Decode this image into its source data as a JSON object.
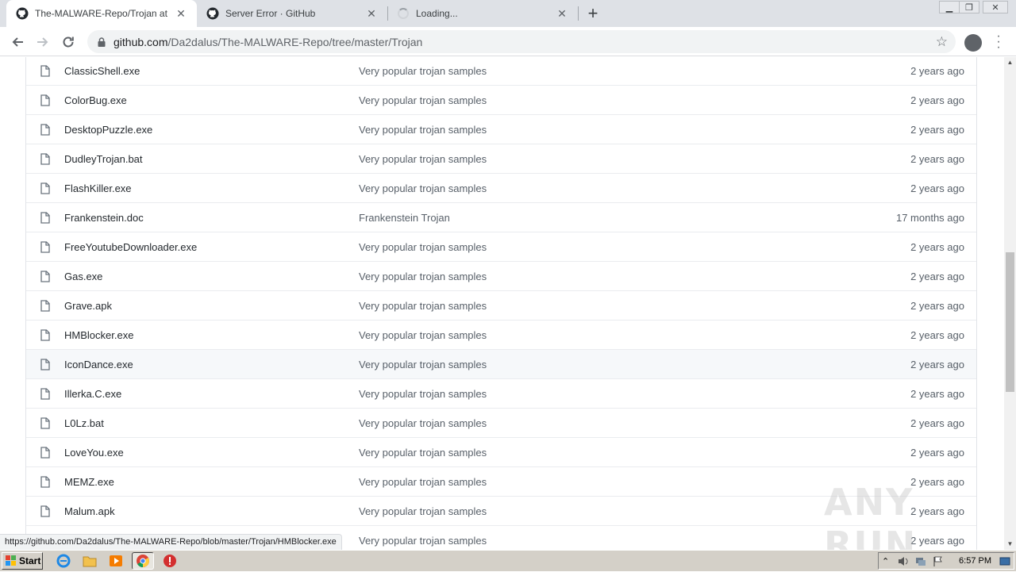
{
  "browser": {
    "tabs": [
      {
        "title": "The-MALWARE-Repo/Trojan at master",
        "active": true
      },
      {
        "title": "Server Error · GitHub",
        "active": false
      },
      {
        "title": "Loading...",
        "active": false
      }
    ],
    "new_tab_label": "+",
    "url_host": "github.com",
    "url_path": "/Da2dalus/The-MALWARE-Repo/tree/master/Trojan"
  },
  "files": [
    {
      "name": "ClassicShell.exe",
      "message": "Very popular trojan samples",
      "age": "2 years ago"
    },
    {
      "name": "ColorBug.exe",
      "message": "Very popular trojan samples",
      "age": "2 years ago"
    },
    {
      "name": "DesktopPuzzle.exe",
      "message": "Very popular trojan samples",
      "age": "2 years ago"
    },
    {
      "name": "DudleyTrojan.bat",
      "message": "Very popular trojan samples",
      "age": "2 years ago"
    },
    {
      "name": "FlashKiller.exe",
      "message": "Very popular trojan samples",
      "age": "2 years ago"
    },
    {
      "name": "Frankenstein.doc",
      "message": "Frankenstein Trojan",
      "age": "17 months ago"
    },
    {
      "name": "FreeYoutubeDownloader.exe",
      "message": "Very popular trojan samples",
      "age": "2 years ago"
    },
    {
      "name": "Gas.exe",
      "message": "Very popular trojan samples",
      "age": "2 years ago"
    },
    {
      "name": "Grave.apk",
      "message": "Very popular trojan samples",
      "age": "2 years ago"
    },
    {
      "name": "HMBlocker.exe",
      "message": "Very popular trojan samples",
      "age": "2 years ago"
    },
    {
      "name": "IconDance.exe",
      "message": "Very popular trojan samples",
      "age": "2 years ago"
    },
    {
      "name": "Illerka.C.exe",
      "message": "Very popular trojan samples",
      "age": "2 years ago"
    },
    {
      "name": "L0Lz.bat",
      "message": "Very popular trojan samples",
      "age": "2 years ago"
    },
    {
      "name": "LoveYou.exe",
      "message": "Very popular trojan samples",
      "age": "2 years ago"
    },
    {
      "name": "MEMZ.exe",
      "message": "Very popular trojan samples",
      "age": "2 years ago"
    },
    {
      "name": "Malum.apk",
      "message": "Very popular trojan samples",
      "age": "2 years ago"
    },
    {
      "name": "",
      "message": "Very popular trojan samples",
      "age": "2 years ago"
    }
  ],
  "hovered_row": 10,
  "status_bar_url": "https://github.com/Da2dalus/The-MALWARE-Repo/blob/master/Trojan/HMBlocker.exe",
  "watermark": "ANY RUN",
  "taskbar": {
    "start_label": "Start",
    "clock": "6:57 PM"
  },
  "colors": {
    "tab_strip": "#dee1e6",
    "row_hover": "#f6f8fa",
    "muted_text": "#586069",
    "taskbar": "#d4d0c8"
  }
}
